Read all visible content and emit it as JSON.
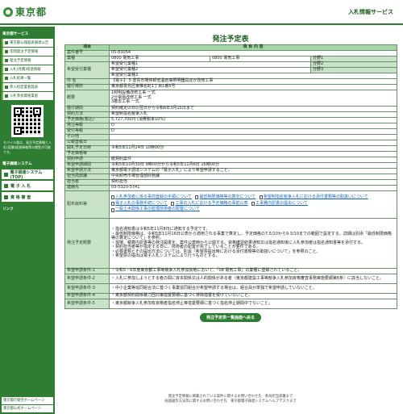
{
  "header": {
    "logo_text": "東京都",
    "service_title": "入札情報サービス"
  },
  "sidebar": {
    "section1_title": "東京都サービス",
    "items": [
      "東京都公報発表調達公告",
      "年間発注予定情報",
      "発注予定情報",
      "入札(見積)経過情報",
      "入札結果一覧",
      "参入指定業者発表",
      "入札参加資格業者"
    ],
    "mobile_note": "モバイル版は、発注予定情報と入札(見積)経過情報等の閲覧が可能です。",
    "section2_title": "電子調達システム",
    "big_items": [
      "電子調達システム(TOP)",
      "電 子 入 札",
      "資 格 審 査"
    ],
    "section3_title": "リンク",
    "links": [
      "東京都庁総合ホームページ",
      "東京都公式ホームページ"
    ]
  },
  "main": {
    "title": "発注予定表",
    "header_left": "項目",
    "header_right": "項 目 内 容",
    "rows": {
      "case_no_label": "案件番号",
      "case_no": "05-83054",
      "category_label": "業種",
      "category_code": "0800",
      "category_name": "電気工事",
      "category_code2": "0800",
      "category_name2": "電気工事",
      "bunrui1": "分野1",
      "bunrui2": "分野2",
      "bunrui3": "分野3",
      "hope_label": "希望受付業種",
      "hope1": "希望受付業種1",
      "hope2": "希望受付業種2",
      "hope3": "希望受付業種3",
      "subject_label": "件 名",
      "subject": "【電子】 5 豊島市場仲卸低温倉庫照明器具ほか改修工事",
      "location_label": "履行場所",
      "location": "東京都豊島区東椎名町1丁目1番5号",
      "summary_label": "概要",
      "summary": "1照明設備改修工事 一式\n2分電盤改修工事 一式\n3撤去工事 一式",
      "period_label": "履行期間",
      "period": "契約確定の日の翌日から令和6年3月15日まで",
      "method_label": "契約方法",
      "method": "希望制指名競争入札",
      "price_label": "予定価格(税込)",
      "price": "5,727,700円 (消費税率10%)",
      "grade_label": "発注等級",
      "grade": "D",
      "reception_label": "受付等級",
      "reception": "D",
      "other_label": "その他",
      "other": "",
      "publish_label": "公報登載日",
      "publish": "",
      "open_label": "開札予定日時",
      "open": "令和5年11月24日 10時00分",
      "schedule_label": "予定価格等",
      "schedule": "",
      "procedure_label": "契約申請",
      "procedure": "紙契約案件",
      "apply_period_label": "希望申請期間",
      "apply_period": "令和5年10月30日 9時00分から令和5年11月6日 16時00分",
      "apply_method_label": "希望申請方法",
      "apply_method": "東京都電子調達システムの「電子入札」により希望申請すること。",
      "dept_label": "担当局部課",
      "dept": "中央卸売市場管理部財務課",
      "person_label": "担当者",
      "person": "契約担当",
      "contact_label": "連絡先",
      "contact": "03-5320-5741",
      "docs_label": "配布資料等",
      "docs": [
        "入札参加者に係る事前登録の手順について",
        "最低制限価格等の算定について",
        "希望制指名競争入札における添付書類等の取扱いについて",
        "電子入札の事務手続について",
        "工事の入札における予定価格の事前公表",
        "工事費内訳書の提出について",
        "一般土木関係工事の監理技術者の配置について"
      ],
      "notes_label": "発注予定概要",
      "notes": "・指名通知書は令和5年11月8日に通知する予定です。\n・最低制限価格は、令和5年11月16日公表から適用される事業で算定し、予定価格の7.5/10から9.3/10までの範囲で設定する。詳細は別添「最低制限価格等の算定について」を参照。\n・現場、積算内訳書等の発注図書を、案件公表時から公開する。資格確認結果通知又は指名通知後に入札参加者は指名通知書等を添付する。\n・契約担当者等が指定する日に、技術者の配置が完了していることが要件である。\n・必要書類とその提出方法については、別添「希望票提出時における添付書類等の取扱いについて」を参照のこと。\n・希望票の提出は電子入札システムにより行うものとする。",
      "cond_label1": "希望申請条件-1",
      "cond1": "・令和5・6年度東京都工事等競争入札参加資格において、「08 電気工事」の業種に登録されていること。",
      "cond_label2": "希望申請条件-2",
      "cond2": "・入札に参加しようとする者の間に資本関係又は人的関係がある者（東京都建設工事等競争入札参加資格審査事務実施要綱第6条）に該当しないこと。",
      "cond_label3": "希望申請条件-3",
      "cond3": "・中小企業等協同組合法に基づく事業協同組合が希望申請する場合は、組合員が単独で希望申請していないこと。",
      "cond_label4": "希望申請条件-4",
      "cond4": "・東京都契約関係暴力団対策措置要綱に基づく排除措置を受けていないこと。",
      "cond_label5": "希望申請条件-5",
      "cond5": "・東京都競争入札参加有資格者指名停止等措置要綱に基づく指名停止期間中でないこと。"
    },
    "back_button": "発注予定表一覧画面へ戻る"
  },
  "footer": {
    "line1": "発注予定情報に掲載されている案件に関するお問い合わせ先　各局担当部署まで",
    "line2": "画面操作方法等に関するお問い合わせ先　東京都電子調達システムヘルプデスクまで"
  }
}
